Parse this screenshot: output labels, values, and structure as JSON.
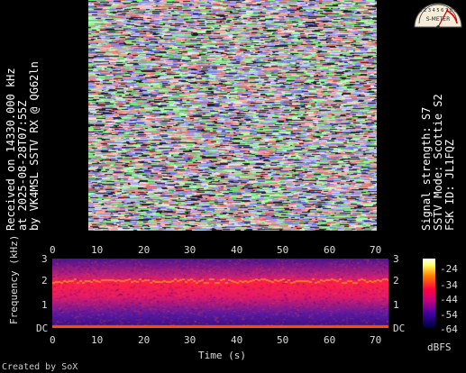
{
  "left_info": [
    "Received on  14330.000 kHz",
    "at 2025-08-28T07:55Z",
    "by VK4MSL SSTV RX @ QG62ln"
  ],
  "right_info": [
    "Signal strength: S7",
    "SSTV Mode: Scottie S2",
    "FSK ID: JL1FQZ"
  ],
  "meter": {
    "scale_text": "1 2 3 4 5 6 7 8 9",
    "units": "S-METER",
    "level": "S7"
  },
  "spectrogram": {
    "time_ticks": [
      "0",
      "10",
      "20",
      "30",
      "40",
      "50",
      "60",
      "70"
    ],
    "freq_ticks_left": [
      "3",
      "2",
      "1",
      "DC"
    ],
    "freq_ticks_right": [
      "3",
      "2",
      "1",
      "DC"
    ],
    "xlabel": "Time (s)",
    "ylabel": "Frequency (kHz)",
    "colorbar_ticks": [
      "-24",
      "-34",
      "-44",
      "-54",
      "-64"
    ],
    "colorbar_unit": "dBFS"
  },
  "footer": "Created by SoX",
  "colors": {
    "background": "#000000",
    "spectrogram_bg": "#5a1aa0",
    "signal_band": "#ff2040",
    "baseline": "#ff5000"
  }
}
